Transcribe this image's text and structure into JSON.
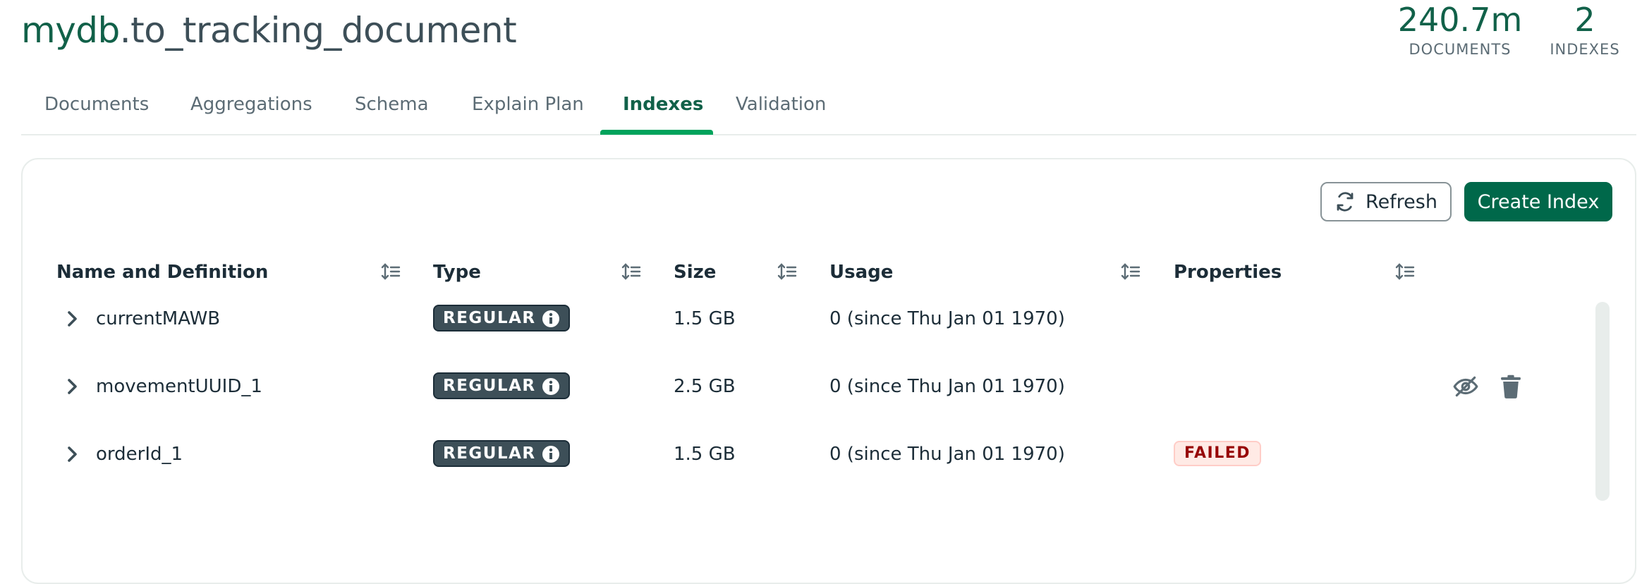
{
  "header": {
    "db_name": "mydb",
    "collection_name": ".to_tracking_document",
    "stats": [
      {
        "value": "240.7m",
        "label": "DOCUMENTS"
      },
      {
        "value": "2",
        "label": "INDEXES"
      }
    ]
  },
  "tabs": [
    {
      "label": "Documents",
      "active": false
    },
    {
      "label": "Aggregations",
      "active": false
    },
    {
      "label": "Schema",
      "active": false
    },
    {
      "label": "Explain Plan",
      "active": false
    },
    {
      "label": "Indexes",
      "active": true
    },
    {
      "label": "Validation",
      "active": false
    }
  ],
  "toolbar": {
    "refresh_label": "Refresh",
    "create_label": "Create Index"
  },
  "table": {
    "columns": [
      "Name and Definition",
      "Type",
      "Size",
      "Usage",
      "Properties"
    ],
    "rows": [
      {
        "name": "currentMAWB",
        "type": "REGULAR",
        "size": "1.5 GB",
        "usage": "0 (since Thu Jan 01 1970)",
        "property": ""
      },
      {
        "name": "movementUUID_1",
        "type": "REGULAR",
        "size": "2.5 GB",
        "usage": "0 (since Thu Jan 01 1970)",
        "property": ""
      },
      {
        "name": "orderId_1",
        "type": "REGULAR",
        "size": "1.5 GB",
        "usage": "0 (since Thu Jan 01 1970)",
        "property": "FAILED"
      }
    ]
  },
  "icons": {
    "refresh": "refresh-icon",
    "sort": "sort-icon",
    "expand": "chevron-right-icon",
    "info": "info-icon",
    "hide": "eye-slash-icon",
    "delete": "trash-icon"
  },
  "colors": {
    "brand_green": "#00684a",
    "accent_green": "#00a35c",
    "title_green": "#116149",
    "badge_dark": "#3d4f58",
    "failed_red": "#970606"
  }
}
